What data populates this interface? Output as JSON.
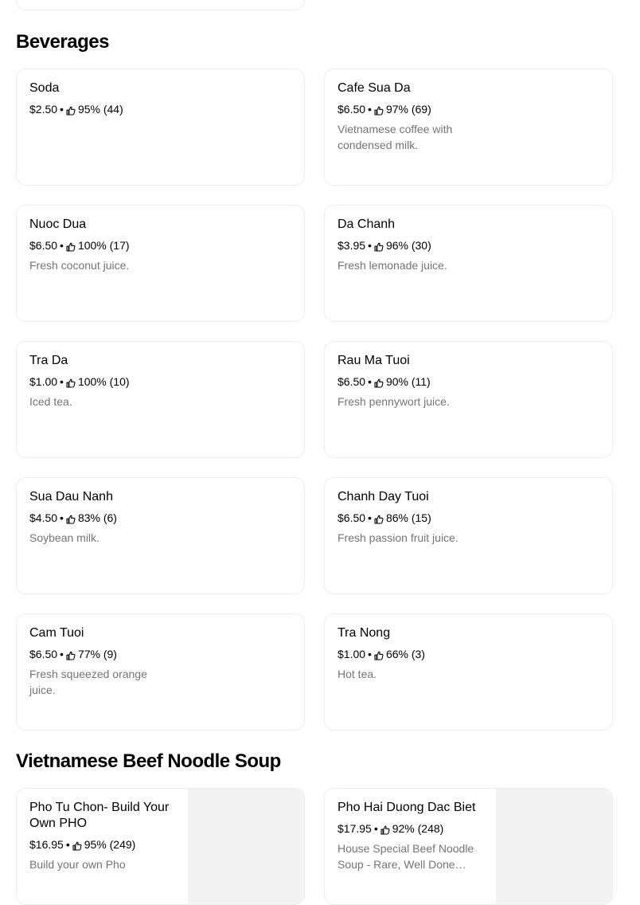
{
  "beverages": {
    "title": "Beverages",
    "items": [
      {
        "name": "Soda",
        "price": "$2.50",
        "rating": "95% (44)",
        "desc": ""
      },
      {
        "name": "Cafe Sua Da",
        "price": "$6.50",
        "rating": "97% (69)",
        "desc": "Vietnamese coffee with condensed milk."
      },
      {
        "name": "Nuoc Dua",
        "price": "$6.50",
        "rating": "100% (17)",
        "desc": "Fresh coconut juice."
      },
      {
        "name": "Da Chanh",
        "price": "$3.95",
        "rating": "96% (30)",
        "desc": "Fresh lemonade juice."
      },
      {
        "name": "Tra Da",
        "price": "$1.00",
        "rating": "100% (10)",
        "desc": "Iced tea."
      },
      {
        "name": "Rau Ma Tuoi",
        "price": "$6.50",
        "rating": "90% (11)",
        "desc": "Fresh pennywort juice."
      },
      {
        "name": "Sua Dau Nanh",
        "price": "$4.50",
        "rating": "83% (6)",
        "desc": "Soybean milk."
      },
      {
        "name": "Chanh Day Tuoi",
        "price": "$6.50",
        "rating": "86% (15)",
        "desc": "Fresh passion fruit juice."
      },
      {
        "name": "Cam Tuoi",
        "price": "$6.50",
        "rating": "77% (9)",
        "desc": "Fresh squeezed orange juice."
      },
      {
        "name": "Tra Nong",
        "price": "$1.00",
        "rating": "66% (3)",
        "desc": "Hot tea."
      }
    ]
  },
  "pho": {
    "title": "Vietnamese Beef Noodle Soup",
    "items": [
      {
        "name": "Pho Tu Chon- Build Your Own PHO",
        "price": "$16.95",
        "rating": "95% (249)",
        "desc": "Build your own Pho"
      },
      {
        "name": "Pho Hai Duong Dac Biet",
        "price": "$17.95",
        "rating": "92% (248)",
        "desc": "House Special Beef Noodle Soup - Rare, Well Done…"
      }
    ]
  },
  "separator": "•",
  "icons": {
    "rating": "thumbs-up-icon"
  },
  "colors": {
    "text": "#000000",
    "muted": "#757575",
    "border": "#eeeeee",
    "image_placeholder": "#f3f3f3"
  }
}
